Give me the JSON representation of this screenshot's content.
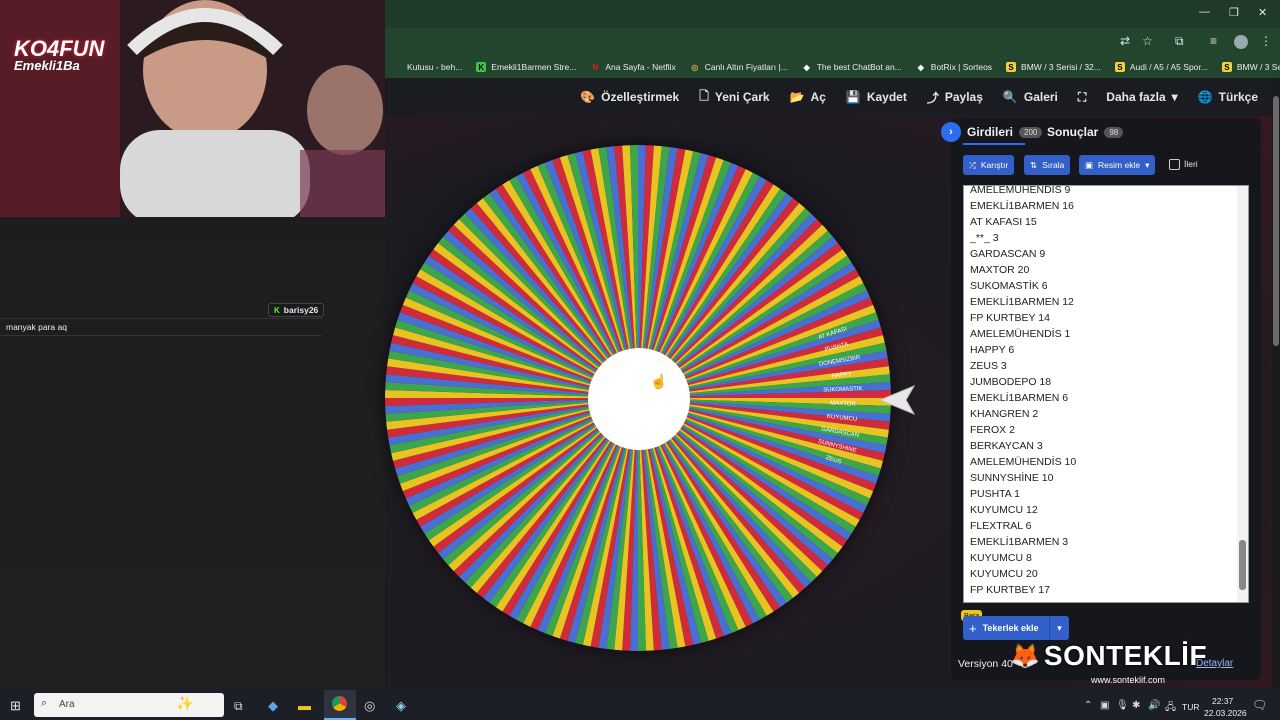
{
  "browser": {
    "bookmarks": [
      {
        "label": "Kutusu - beh...",
        "icon_color": "#e8e8e8",
        "icon_char": ""
      },
      {
        "label": "Emekli1Barmen Stre...",
        "icon_color": "#3ec44a",
        "icon_char": "K"
      },
      {
        "label": "Ana Sayfa - Netflix",
        "icon_color": "#d3202a",
        "icon_char": "N"
      },
      {
        "label": "Canlı Altın Fiyatları |...",
        "icon_color": "#c9a74a",
        "icon_char": "◎"
      },
      {
        "label": "The best ChatBot an...",
        "icon_color": "#ffffff",
        "icon_char": "◆"
      },
      {
        "label": "BotRix | Sorteos",
        "icon_color": "#ffffff",
        "icon_char": "◆"
      },
      {
        "label": "BMW / 3 Serisi / 32...",
        "icon_color": "#f2d23a",
        "icon_char": "S"
      },
      {
        "label": "Audi / A5 / A5 Spor...",
        "icon_color": "#f2d23a",
        "icon_char": "S"
      },
      {
        "label": "BMW / 3 Serisi / 32...",
        "icon_color": "#f2d23a",
        "icon_char": "S"
      }
    ]
  },
  "topnav": [
    {
      "label": "Özelleştirmek",
      "icon": "palette-icon",
      "glyph": "🎨"
    },
    {
      "label": "Yeni Çark",
      "icon": "file-icon",
      "glyph": "🗋"
    },
    {
      "label": "Aç",
      "icon": "folder-icon",
      "glyph": "📂"
    },
    {
      "label": "Kaydet",
      "icon": "save-icon",
      "glyph": "💾"
    },
    {
      "label": "Paylaş",
      "icon": "share-icon",
      "glyph": "⤴"
    },
    {
      "label": "Galeri",
      "icon": "search-icon",
      "glyph": "🔍"
    },
    {
      "label": "",
      "icon": "fullscreen-icon",
      "glyph": "⛶"
    },
    {
      "label": "Daha fazla",
      "icon": "chevron-down-icon",
      "glyph": "▾"
    },
    {
      "label": "Türkçe",
      "icon": "globe-icon",
      "glyph": "🌐"
    }
  ],
  "panel": {
    "tab_entries": "Girdileri",
    "tab_entries_count": "200",
    "tab_results": "Sonuçlar",
    "tab_results_count": "98",
    "shuffle_label": "Karıştır",
    "sort_label": "Sırala",
    "add_image_label": "Resim ekle",
    "advanced_label": "İleri",
    "entries": [
      "AMELEMÜHENDİS 9",
      "EMEKLİ1BARMEN 16",
      "AT KAFASI 15",
      "_**_ 3",
      "GARDASCAN 9",
      "MAXTOR 20",
      "SUKOMASTİK 6",
      "EMEKLİ1BARMEN 12",
      "FP KURTBEY 14",
      "AMELEMÜHENDİS 1",
      "HAPPY 6",
      "ZEUS 3",
      "JUMBODEPO 18",
      "EMEKLİ1BARMEN 6",
      "KHANGREN 2",
      "FEROX 2",
      "BERKAYCAN 3",
      "AMELEMÜHENDİS 10",
      "SUNNYSHİNE 10",
      "PUSHTA 1",
      "KUYUMCU 12",
      "FLEXTRAL 6",
      "EMEKLİ1BARMEN 3",
      "KUYUMCU 8",
      "KUYUMCU 20",
      "FP KURTBEY 17"
    ],
    "beta_label": "Beta",
    "add_wheel_label": "Tekerlek ekle",
    "version_label": "Versiyon 40",
    "details_label": "Detaylar"
  },
  "wheel": {
    "colors": [
      "#e8c423",
      "#3da64a",
      "#4a6fd3",
      "#d12a3a"
    ],
    "segment_count": 200,
    "labels": [
      "AT KAFASI",
      "PUSHTA",
      "DONEMSIZBIR",
      "HAPPY",
      "SUKOMASTIK",
      "MAXTOR",
      "KUYUMCU",
      "GARDASCAN",
      "SUNNYSHINE",
      "ZEUS"
    ]
  },
  "stream": {
    "overlay_logo": "KO4FUN",
    "overlay_sub": "Emekli1Ba",
    "chat_user": "barisy26",
    "chat_message": "manyak para aq",
    "watermark": "SONTEKLİF",
    "watermark_url": "www.sonteklif.com"
  },
  "taskbar": {
    "search_placeholder": "Ara",
    "lang": "TUR",
    "time": "22:37",
    "date": "22.03.2026"
  }
}
